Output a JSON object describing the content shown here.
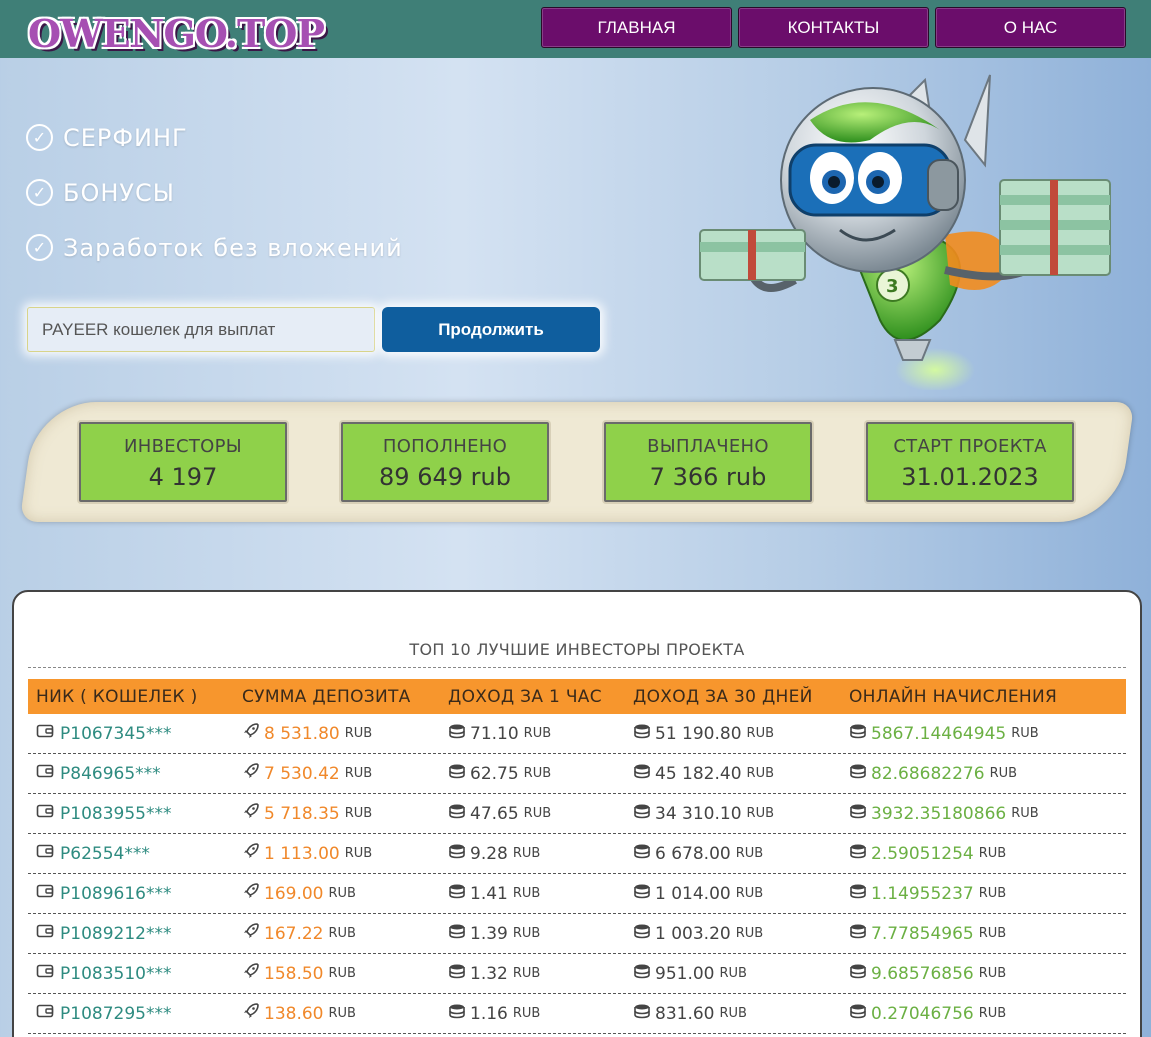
{
  "header": {
    "logo": "OWENGO.TOP",
    "nav": [
      "ГЛАВНАЯ",
      "КОНТАКТЫ",
      "О НАС"
    ]
  },
  "features": [
    "СЕРФИНГ",
    "БОНУСЫ",
    "Заработок без вложений"
  ],
  "form": {
    "placeholder": "PAYEER кошелек для выплат",
    "button": "Продолжить"
  },
  "stats": [
    {
      "label": "ИНВЕСТОРЫ",
      "value": "4 197"
    },
    {
      "label": "ПОПОЛНЕНО",
      "value": "89 649 rub"
    },
    {
      "label": "ВЫПЛАЧЕНО",
      "value": "7 366 rub"
    },
    {
      "label": "СТАРТ ПРОЕКТА",
      "value": "31.01.2023"
    }
  ],
  "table": {
    "title": "ТОП 10 ЛУЧШИЕ ИНВЕСТОРЫ ПРОЕКТА",
    "headers": [
      "НИК ( КОШЕЛЕК )",
      "СУММА ДЕПОЗИТА",
      "ДОХОД ЗА 1 ЧАС",
      "ДОХОД ЗА 30 ДНЕЙ",
      "ОНЛАЙН НАЧИСЛЕНИЯ"
    ],
    "unit": "RUB",
    "rows": [
      {
        "nick": "P1067345***",
        "deposit": "8 531.80",
        "hour": "71.10",
        "month": "51 190.80",
        "online": "5867.14464945"
      },
      {
        "nick": "P846965***",
        "deposit": "7 530.42",
        "hour": "62.75",
        "month": "45 182.40",
        "online": "82.68682276"
      },
      {
        "nick": "P1083955***",
        "deposit": "5 718.35",
        "hour": "47.65",
        "month": "34 310.10",
        "online": "3932.35180866"
      },
      {
        "nick": "P62554***",
        "deposit": "1 113.00",
        "hour": "9.28",
        "month": "6 678.00",
        "online": "2.59051254"
      },
      {
        "nick": "P1089616***",
        "deposit": "169.00",
        "hour": "1.41",
        "month": "1 014.00",
        "online": "1.14955237"
      },
      {
        "nick": "P1089212***",
        "deposit": "167.22",
        "hour": "1.39",
        "month": "1 003.20",
        "online": "7.77854965"
      },
      {
        "nick": "P1083510***",
        "deposit": "158.50",
        "hour": "1.32",
        "month": "951.00",
        "online": "9.68576856"
      },
      {
        "nick": "P1087295***",
        "deposit": "138.60",
        "hour": "1.16",
        "month": "831.60",
        "online": "0.27046756"
      }
    ]
  }
}
